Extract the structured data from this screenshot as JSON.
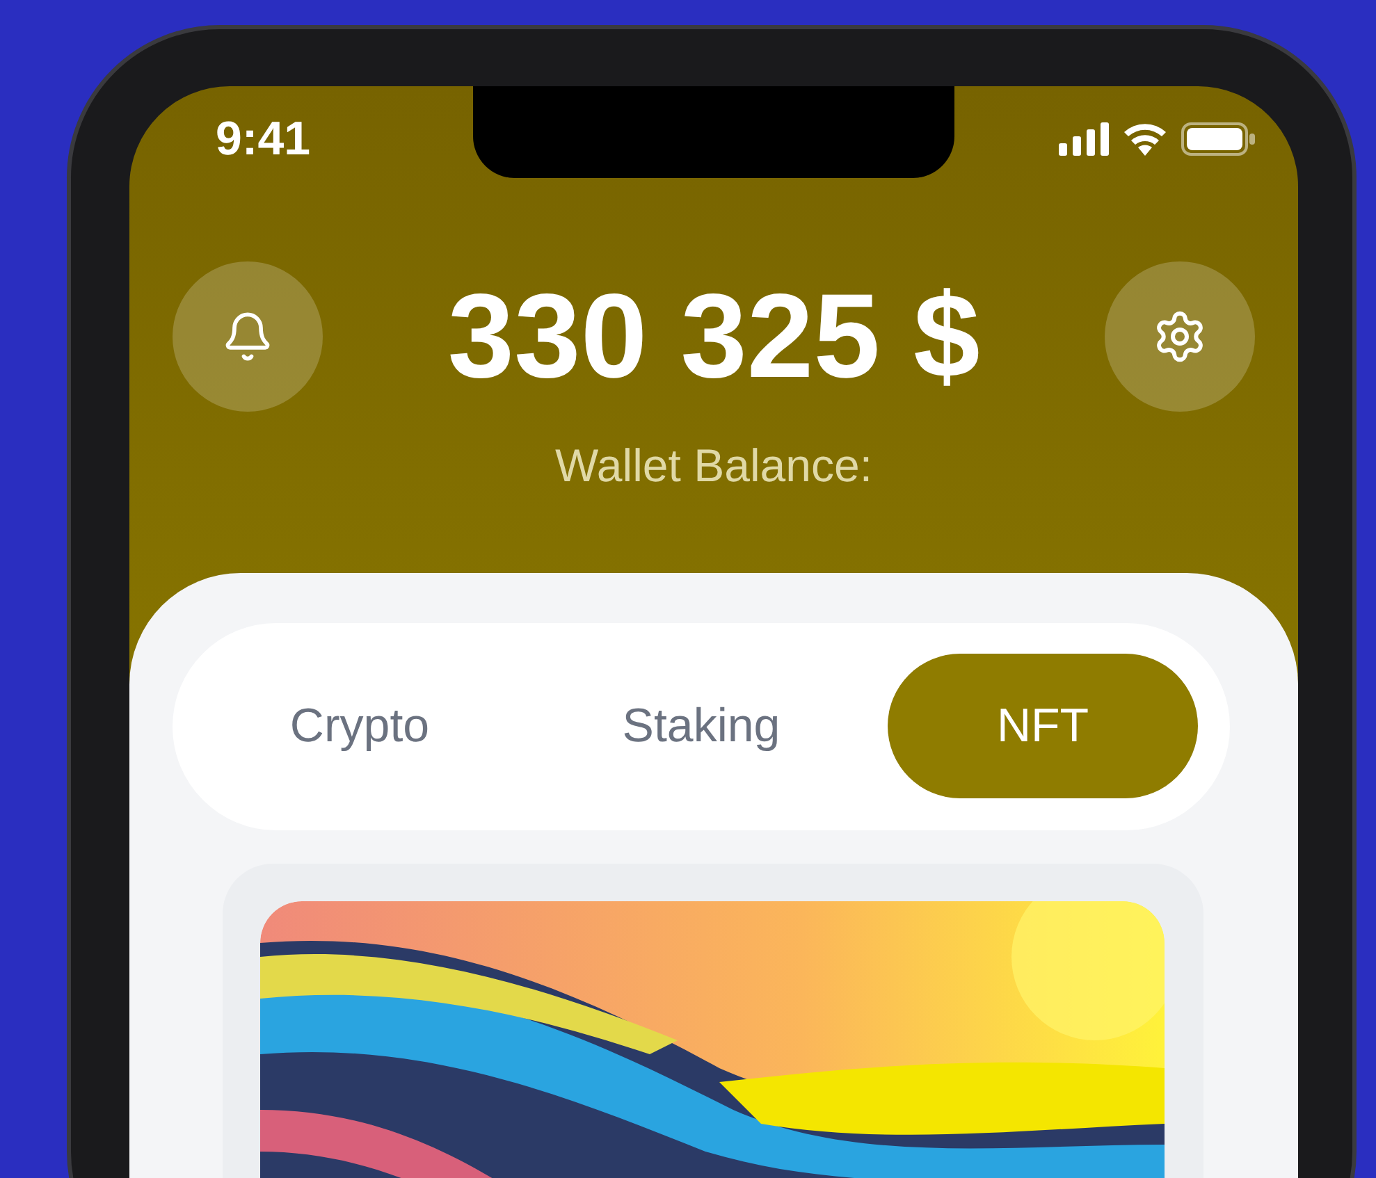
{
  "status_bar": {
    "time": "9:41"
  },
  "header": {
    "balance": "330 325 $",
    "label": "Wallet Balance:"
  },
  "tabs": [
    {
      "label": "Crypto",
      "selected": false
    },
    {
      "label": "Staking",
      "selected": false
    },
    {
      "label": "NFT",
      "selected": true
    }
  ]
}
